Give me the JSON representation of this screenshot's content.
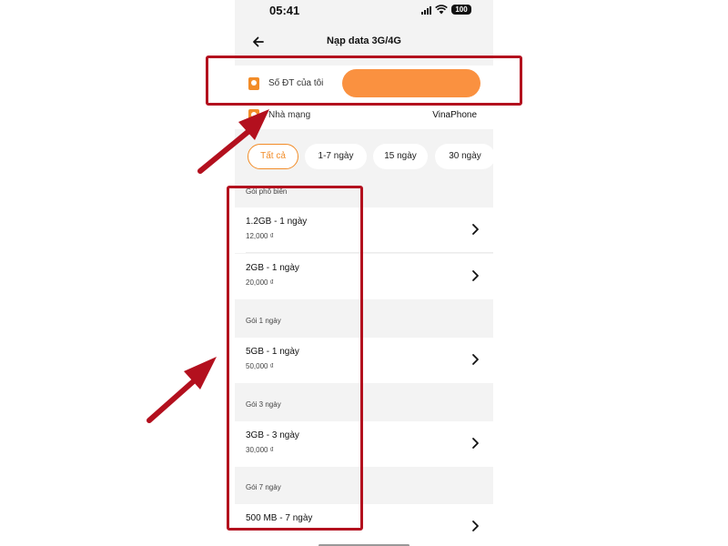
{
  "status_bar": {
    "time": "05:41",
    "battery": "100"
  },
  "header": {
    "title": "Nạp data 3G/4G"
  },
  "phone_field": {
    "label": "Số ĐT của tôi",
    "value": ""
  },
  "carrier": {
    "label": "Nhà mạng",
    "value": "VinaPhone"
  },
  "filters": [
    {
      "label": "Tất cả",
      "active": true
    },
    {
      "label": "1-7 ngày",
      "active": false
    },
    {
      "label": "15 ngày",
      "active": false
    },
    {
      "label": "30 ngày",
      "active": false
    }
  ],
  "sections": [
    {
      "title": "Gói phổ biến",
      "items": [
        {
          "name": "1.2GB - 1 ngày",
          "price": "12,000 ₫"
        },
        {
          "name": "2GB - 1 ngày",
          "price": "20,000 ₫"
        }
      ]
    },
    {
      "title": "Gói 1 ngày",
      "items": [
        {
          "name": "5GB - 1 ngày",
          "price": "50,000 ₫"
        }
      ]
    },
    {
      "title": "Gói 3 ngày",
      "items": [
        {
          "name": "3GB - 3 ngày",
          "price": "30,000 ₫"
        }
      ]
    },
    {
      "title": "Gói 7 ngày",
      "items": [
        {
          "name": "500 MB - 7 ngày",
          "price": ""
        }
      ]
    }
  ],
  "colors": {
    "accent": "#f28c28",
    "input_fill": "#fa9140",
    "annotation": "#b3101e",
    "background": "#f3f3f3"
  },
  "icons": [
    "back-arrow-icon",
    "contact-icon",
    "carrier-icon",
    "chevron-right-icon",
    "wifi-icon",
    "signal-icon",
    "battery-icon",
    "annotation-arrow-icon"
  ]
}
